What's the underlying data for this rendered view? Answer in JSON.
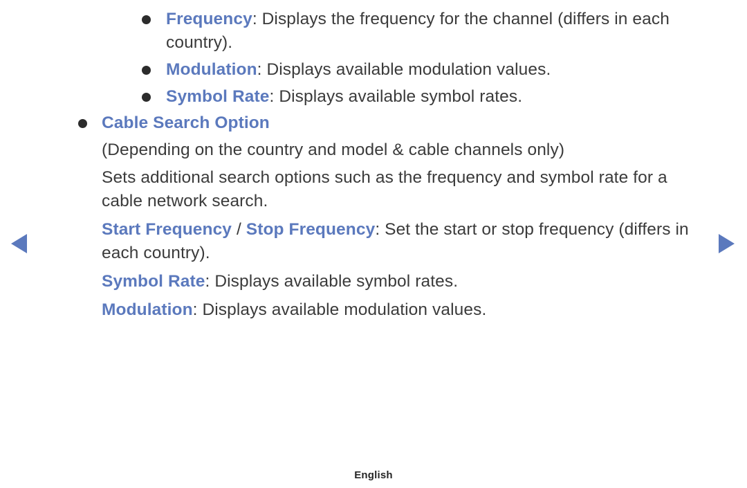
{
  "colors": {
    "term_blue": "#5b79bd",
    "body_text": "#3b3b3b",
    "bullet": "#2c2c2c",
    "arrow_blue": "#5b79bd",
    "background": "#ffffff"
  },
  "nav": {
    "prev_label": "◀",
    "next_label": "▶",
    "prev_icon": "triangle-left-icon",
    "next_icon": "triangle-right-icon"
  },
  "content": {
    "frequency": {
      "term": "Frequency",
      "description": ": Displays the frequency for the channel (differs in each country)."
    },
    "modulation": {
      "term": "Modulation",
      "description": ": Displays available modulation values."
    },
    "symbol_rate": {
      "term": "Symbol Rate",
      "description": ": Displays available symbol rates."
    },
    "cable_search_option": {
      "heading": "Cable Search Option",
      "note": "(Depending on the country and model & cable channels only)",
      "body": "Sets additional search options such as the frequency and symbol rate for a cable network search."
    },
    "start_stop_frequency": {
      "term_start": "Start Frequency",
      "separator": " / ",
      "term_stop": "Stop Frequency",
      "description": ": Set the start or stop frequency (differs in each country)."
    },
    "symbol_rate_2": {
      "term": "Symbol Rate",
      "description": ": Displays available symbol rates."
    },
    "modulation_2": {
      "term": "Modulation",
      "description": ": Displays available modulation values."
    }
  },
  "footer": {
    "language": "English"
  }
}
